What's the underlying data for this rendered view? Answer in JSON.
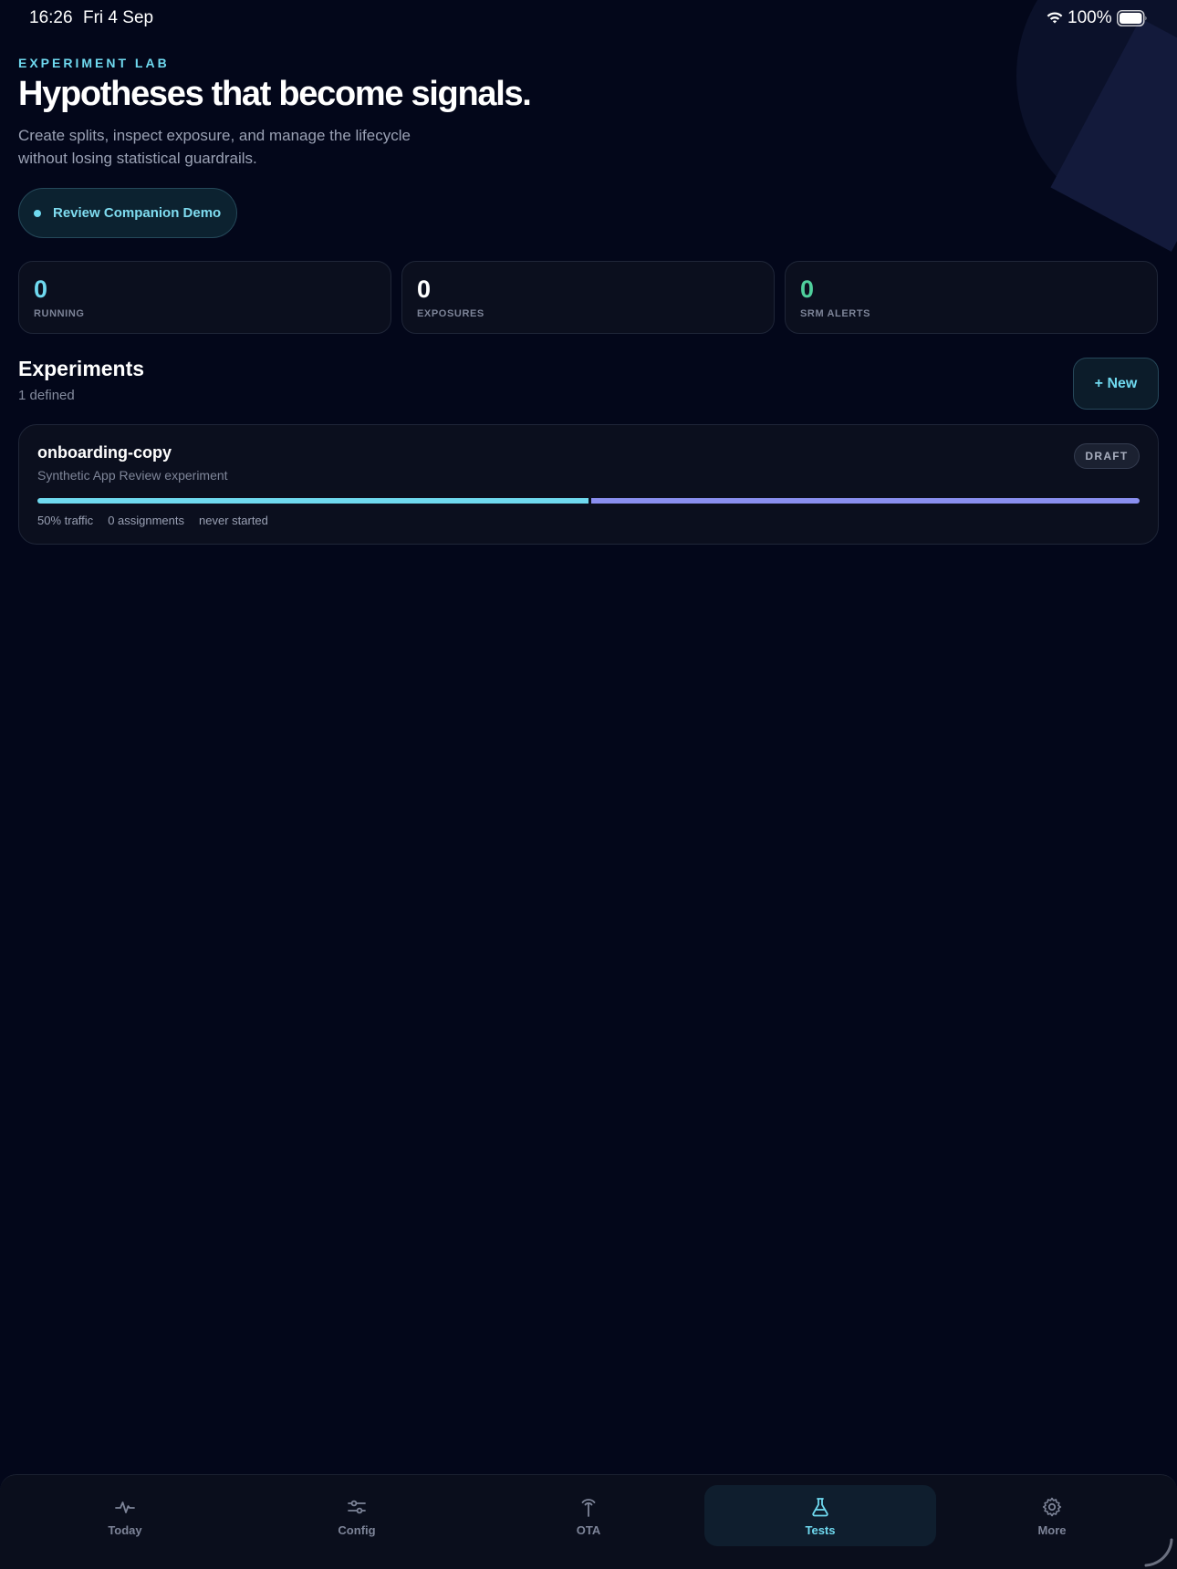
{
  "status_bar": {
    "time": "16:26",
    "date": "Fri 4 Sep",
    "battery": "100%",
    "wifi_icon": "wifi-icon",
    "battery_icon": "battery-icon"
  },
  "header": {
    "eyebrow": "EXPERIMENT LAB",
    "title": "Hypotheses that become signals.",
    "subtitle": "Create splits, inspect exposure, and manage the lifecycle without losing statistical guardrails.",
    "demo_button": "Review Companion Demo"
  },
  "stats": [
    {
      "value": "0",
      "label": "RUNNING",
      "color": "#6fd9ef"
    },
    {
      "value": "0",
      "label": "EXPOSURES",
      "color": "#ffffff"
    },
    {
      "value": "0",
      "label": "SRM ALERTS",
      "color": "#4fcf9c"
    }
  ],
  "experiments_section": {
    "title": "Experiments",
    "count": "1 defined",
    "new_button": "+ New"
  },
  "experiments": [
    {
      "name": "onboarding-copy",
      "description": "Synthetic App Review experiment",
      "status": "DRAFT",
      "split_fraction": 0.5,
      "traffic": "50% traffic",
      "assignments": "0 assignments",
      "started": "never started"
    }
  ],
  "tab_bar": {
    "active": "Tests",
    "tabs": [
      {
        "label": "Today",
        "icon": "pulse-icon"
      },
      {
        "label": "Config",
        "icon": "sliders-icon"
      },
      {
        "label": "OTA",
        "icon": "antenna-icon"
      },
      {
        "label": "Tests",
        "icon": "flask-icon"
      },
      {
        "label": "More",
        "icon": "gear-icon"
      }
    ]
  },
  "colors": {
    "accent": "#6fd9ef",
    "split_b": "#8a8ff0",
    "background": "#03071a"
  }
}
